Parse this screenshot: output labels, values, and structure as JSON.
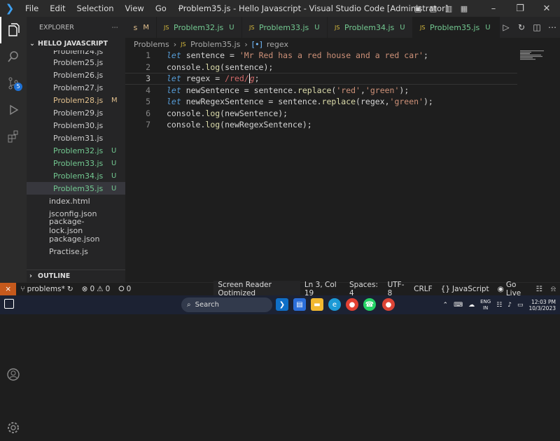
{
  "window": {
    "title": "Problem35.js - Hello Javascript - Visual Studio Code [Administrator]"
  },
  "menu": [
    "File",
    "Edit",
    "Selection",
    "View",
    "Go",
    "⋯"
  ],
  "explorer": {
    "header": "EXPLORER",
    "folder": "HELLO JAVASCRIPT",
    "outline": "OUTLINE"
  },
  "files": [
    {
      "name": "Problem24.js",
      "status": "",
      "color": "#cccccc",
      "js": true
    },
    {
      "name": "Problem25.js",
      "status": "",
      "color": "#cccccc",
      "js": true
    },
    {
      "name": "Problem26.js",
      "status": "",
      "color": "#cccccc",
      "js": true
    },
    {
      "name": "Problem27.js",
      "status": "",
      "color": "#cccccc",
      "js": true
    },
    {
      "name": "Problem28.js",
      "status": "M",
      "color": "#e2c08d",
      "js": true
    },
    {
      "name": "Problem29.js",
      "status": "",
      "color": "#cccccc",
      "js": true
    },
    {
      "name": "Problem30.js",
      "status": "",
      "color": "#cccccc",
      "js": true
    },
    {
      "name": "Problem31.js",
      "status": "",
      "color": "#cccccc",
      "js": true
    },
    {
      "name": "Problem32.js",
      "status": "U",
      "color": "#73c991",
      "js": true
    },
    {
      "name": "Problem33.js",
      "status": "U",
      "color": "#73c991",
      "js": true
    },
    {
      "name": "Problem34.js",
      "status": "U",
      "color": "#73c991",
      "js": true
    },
    {
      "name": "Problem35.js",
      "status": "U",
      "color": "#73c991",
      "js": true,
      "selected": true
    },
    {
      "name": "index.html",
      "status": "",
      "color": "#cccccc",
      "js": false
    },
    {
      "name": "jsconfig.json",
      "status": "",
      "color": "#cccccc",
      "js": false
    },
    {
      "name": "package-lock.json",
      "status": "",
      "color": "#cccccc",
      "js": false
    },
    {
      "name": "package.json",
      "status": "",
      "color": "#cccccc",
      "js": false
    },
    {
      "name": "Practise.js",
      "status": "",
      "color": "#cccccc",
      "js": false
    }
  ],
  "tabs": [
    {
      "label": "s",
      "status": "M",
      "color": "#e2c08d"
    },
    {
      "label": "Problem32.js",
      "status": "U",
      "color": "#73c991"
    },
    {
      "label": "Problem33.js",
      "status": "U",
      "color": "#73c991"
    },
    {
      "label": "Problem34.js",
      "status": "U",
      "color": "#73c991"
    },
    {
      "label": "Problem35.js",
      "status": "U",
      "color": "#73c991",
      "active": true
    }
  ],
  "breadcrumb": {
    "folder": "Problems",
    "file": "Problem35.js",
    "symbol": "regex"
  },
  "code": {
    "line_numbers": [
      "1",
      "2",
      "3",
      "4",
      "5",
      "6",
      "7"
    ],
    "l1": {
      "kw": "let",
      "rest1": " sentence = ",
      "str": "'Mr Red has a red house and a red car'",
      "end": ";"
    },
    "l2": {
      "obj": "console.",
      "fn": "log",
      "rest": "(sentence);"
    },
    "l3": {
      "kw": "let",
      "rest1": " regex = ",
      "rx": "/red/",
      "flag": "g",
      "end": ";"
    },
    "l4": {
      "kw": "let",
      "rest1": " newSentence = sentence.",
      "fn": "replace",
      "p1": "(",
      "s1": "'red'",
      "c": ",",
      "s2": "'green'",
      "end": ");"
    },
    "l5": {
      "kw": "let",
      "rest1": " newRegexSentence = sentence.",
      "fn": "replace",
      "p1": "(regex,",
      "s2": "'green'",
      "end": ");"
    },
    "l6": {
      "obj": "console.",
      "fn": "log",
      "rest": "(newSentence);"
    },
    "l7": {
      "obj": "console.",
      "fn": "log",
      "rest": "(newRegexSentence);"
    }
  },
  "status": {
    "branch": "problems*",
    "errors": "0",
    "warnings": "0",
    "ports": "0",
    "reader": "Screen Reader Optimized",
    "position": "Ln 3, Col 19",
    "spaces": "Spaces: 4",
    "encoding": "UTF-8",
    "eol": "CRLF",
    "language": "JavaScript",
    "golive": "Go Live"
  },
  "badges": {
    "scm": "5"
  },
  "taskbar": {
    "search": "Search",
    "lang1": "ENG",
    "lang2": "IN",
    "time": "12:03 PM",
    "date": "10/3/2023"
  }
}
